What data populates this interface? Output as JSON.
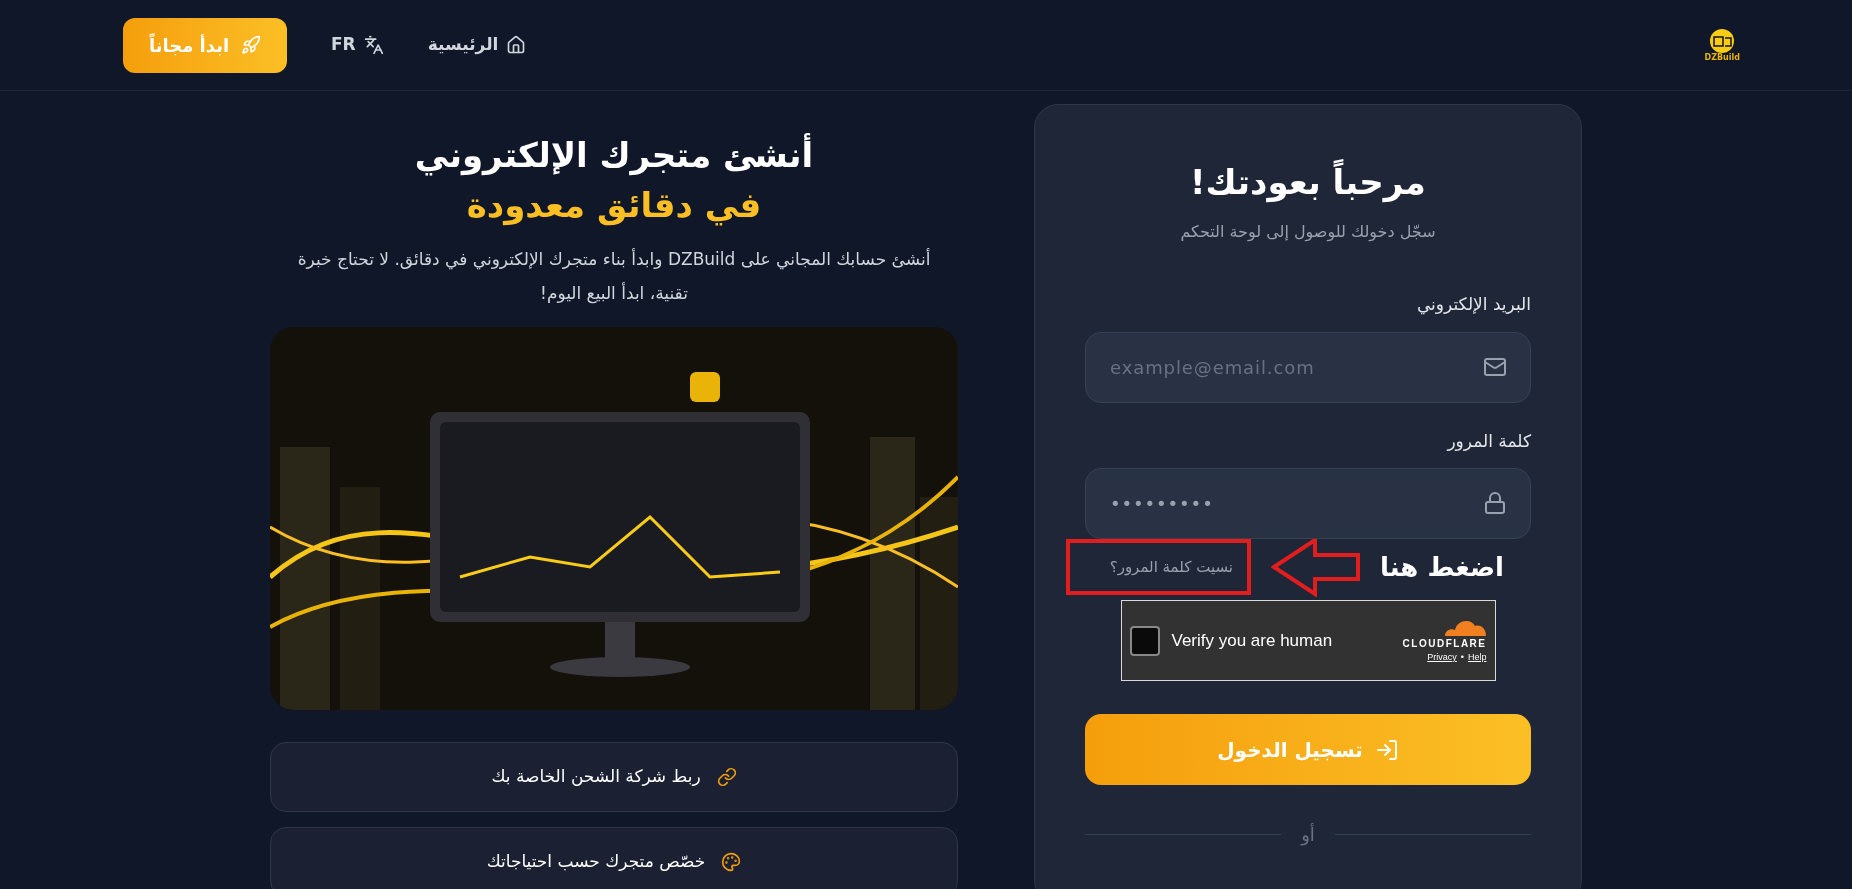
{
  "header": {
    "logo": "DZBuild",
    "nav": [
      {
        "label": "الرئيسية"
      },
      {
        "label": "FR"
      }
    ],
    "cta": "ابدأ مجاناً"
  },
  "hero": {
    "title": "أنشئ متجرك الإلكتروني",
    "title_highlight": "في دقائق معدودة",
    "description": "أنشئ حسابك المجاني على DZBuild وابدأ بناء متجرك الإلكتروني في دقائق. لا تحتاج خبرة تقنية، ابدأ البيع اليوم!",
    "features": [
      {
        "label": "ربط شركة الشحن الخاصة بك"
      },
      {
        "label": "خصّص متجرك حسب احتياجاتك"
      }
    ]
  },
  "login": {
    "title": "مرحباً بعودتك!",
    "subtitle": "سجّل دخولك للوصول إلى لوحة التحكم",
    "fields": [
      {
        "label": "البريد الإلكتروني",
        "placeholder": "example@email.com"
      },
      {
        "label": "كلمة المرور",
        "value": "•••••••••"
      }
    ],
    "forgot_link": "نسيت كلمة المرور؟",
    "annotation": "اضغط هنا",
    "captcha": {
      "checked": false,
      "label": "Verify you are human",
      "brand": "CLOUDFLARE",
      "privacy_link": "Privacy",
      "separator": "•",
      "help_link": "Help"
    },
    "submit": "تسجيل الدخول",
    "divider": "أو"
  }
}
